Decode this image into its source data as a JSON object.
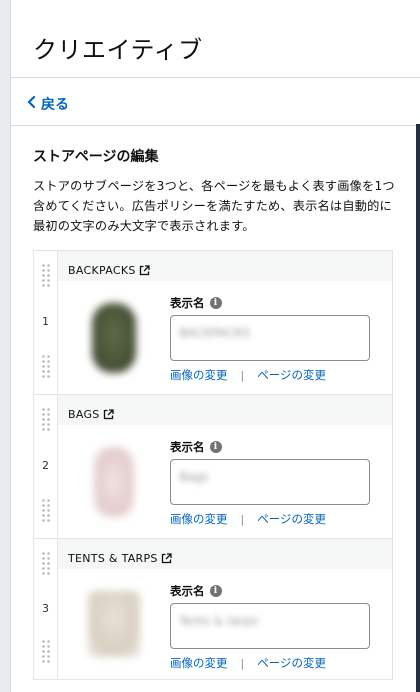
{
  "header": {
    "title": "クリエイティブ"
  },
  "nav": {
    "back_label": "戻る"
  },
  "section": {
    "title": "ストアページの編集",
    "description": "ストアのサブページを3つと、各ページを最もよく表す画像を1つ含めてください。広告ポリシーを満たすため、表示名は自動的に最初の文字のみ大文字で表示されます。"
  },
  "pages": [
    {
      "index": "1",
      "name": "BACKPACKS",
      "field_label": "表示名",
      "display_name": "BACKPACKS",
      "change_image": "画像の変更",
      "separator": "|",
      "change_page": "ページの変更"
    },
    {
      "index": "2",
      "name": "BAGS",
      "field_label": "表示名",
      "display_name": "Bags",
      "change_image": "画像の変更",
      "separator": "|",
      "change_page": "ページの変更"
    },
    {
      "index": "3",
      "name": "TENTS & TARPS",
      "field_label": "表示名",
      "display_name": "Tents & tarps",
      "change_image": "画像の変更",
      "separator": "|",
      "change_page": "ページの変更"
    }
  ],
  "icons": {
    "back": "chevron-left-icon",
    "external": "external-link-icon",
    "info": "info-icon",
    "drag": "drag-handle-icon"
  },
  "colors": {
    "link": "#0066c0",
    "sidebar": "#232f3e",
    "header_bg": "#f5f6f6"
  }
}
